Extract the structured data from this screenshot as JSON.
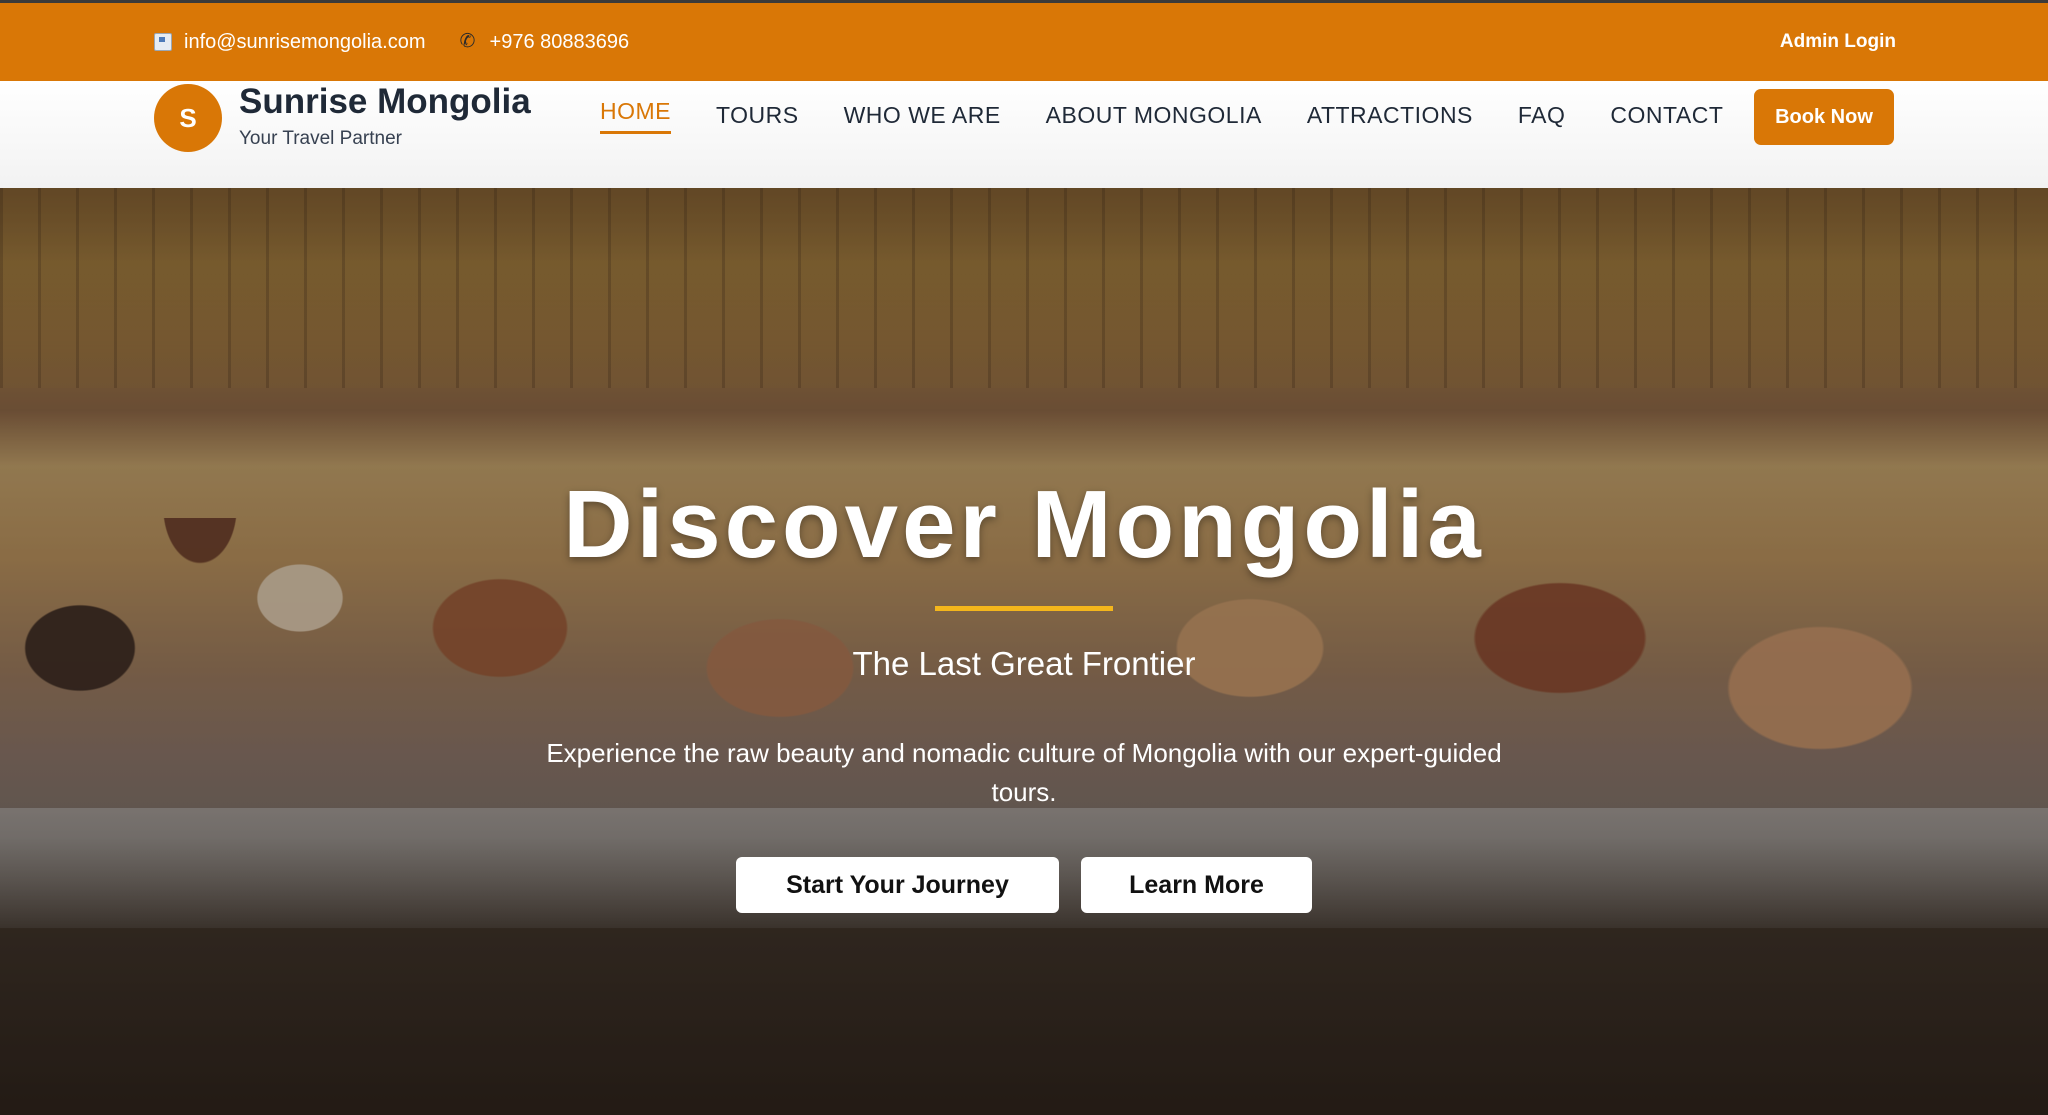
{
  "topbar": {
    "email": "info@sunrisemongolia.com",
    "email_icon": "mail-icon",
    "phone": "+976 80883696",
    "phone_icon": "phone-icon",
    "admin_login": "Admin Login"
  },
  "brand": {
    "initial": "S",
    "name": "Sunrise Mongolia",
    "tagline": "Your Travel Partner"
  },
  "nav": {
    "items": [
      "HOME",
      "TOURS",
      "WHO WE ARE",
      "ABOUT MONGOLIA",
      "ATTRACTIONS",
      "FAQ",
      "CONTACT"
    ],
    "active": "HOME",
    "book_now": "Book Now"
  },
  "hero": {
    "title": "Discover Mongolia",
    "subtitle": "The Last Great Frontier",
    "description": "Experience the raw beauty and nomadic culture of Mongolia with our expert-guided tours.",
    "primary_button": "Start Your Journey",
    "secondary_button": "Learn More"
  },
  "colors": {
    "accent": "#d97706",
    "title_underline": "#f4b61c",
    "heading_text": "#1f2937"
  }
}
